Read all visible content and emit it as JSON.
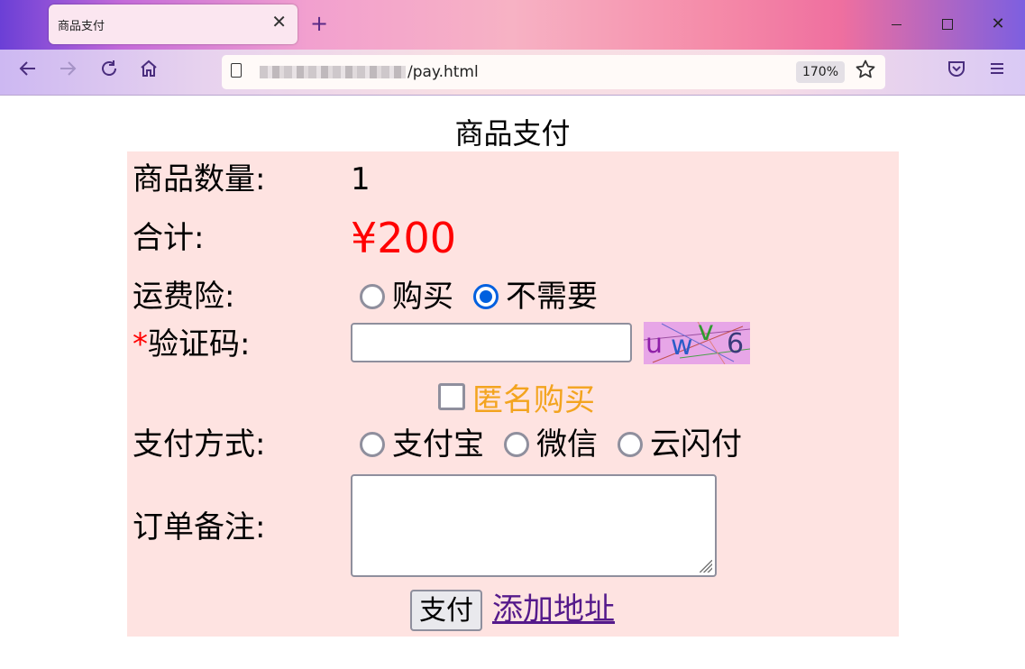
{
  "browser": {
    "tab_title": "商品支付",
    "tab_close": "✕",
    "new_tab": "+",
    "win_close": "✕",
    "url_suffix": "/pay.html",
    "zoom": "170%"
  },
  "page": {
    "title": "商品支付",
    "quantity_label": "商品数量:",
    "quantity_value": "1",
    "total_label": "合计:",
    "total_value": "¥200",
    "insurance_label": "运费险:",
    "insurance_options": [
      {
        "label": "购买",
        "checked": false
      },
      {
        "label": "不需要",
        "checked": true
      }
    ],
    "captcha_required_mark": "*",
    "captcha_label": "验证码:",
    "captcha_input_value": "",
    "captcha_chars": [
      "u",
      "w",
      "v",
      "6"
    ],
    "anonymous_label": "匿名购买",
    "payment_label": "支付方式:",
    "payment_options": [
      {
        "label": "支付宝",
        "checked": false
      },
      {
        "label": "微信",
        "checked": false
      },
      {
        "label": "云闪付",
        "checked": false
      }
    ],
    "note_label": "订单备注:",
    "note_value": "",
    "pay_button": "支付",
    "add_address_link": "添加地址"
  },
  "colors": {
    "form_background": "#fee3e1",
    "price": "#ff0000",
    "anonymous_text": "#f3a41f",
    "link": "#551a8b",
    "radio_checked": "#0060df"
  },
  "icons": [
    "back-icon",
    "forward-icon",
    "reload-icon",
    "home-icon",
    "page-info-icon",
    "bookmark-star-icon",
    "pocket-icon",
    "menu-icon"
  ]
}
